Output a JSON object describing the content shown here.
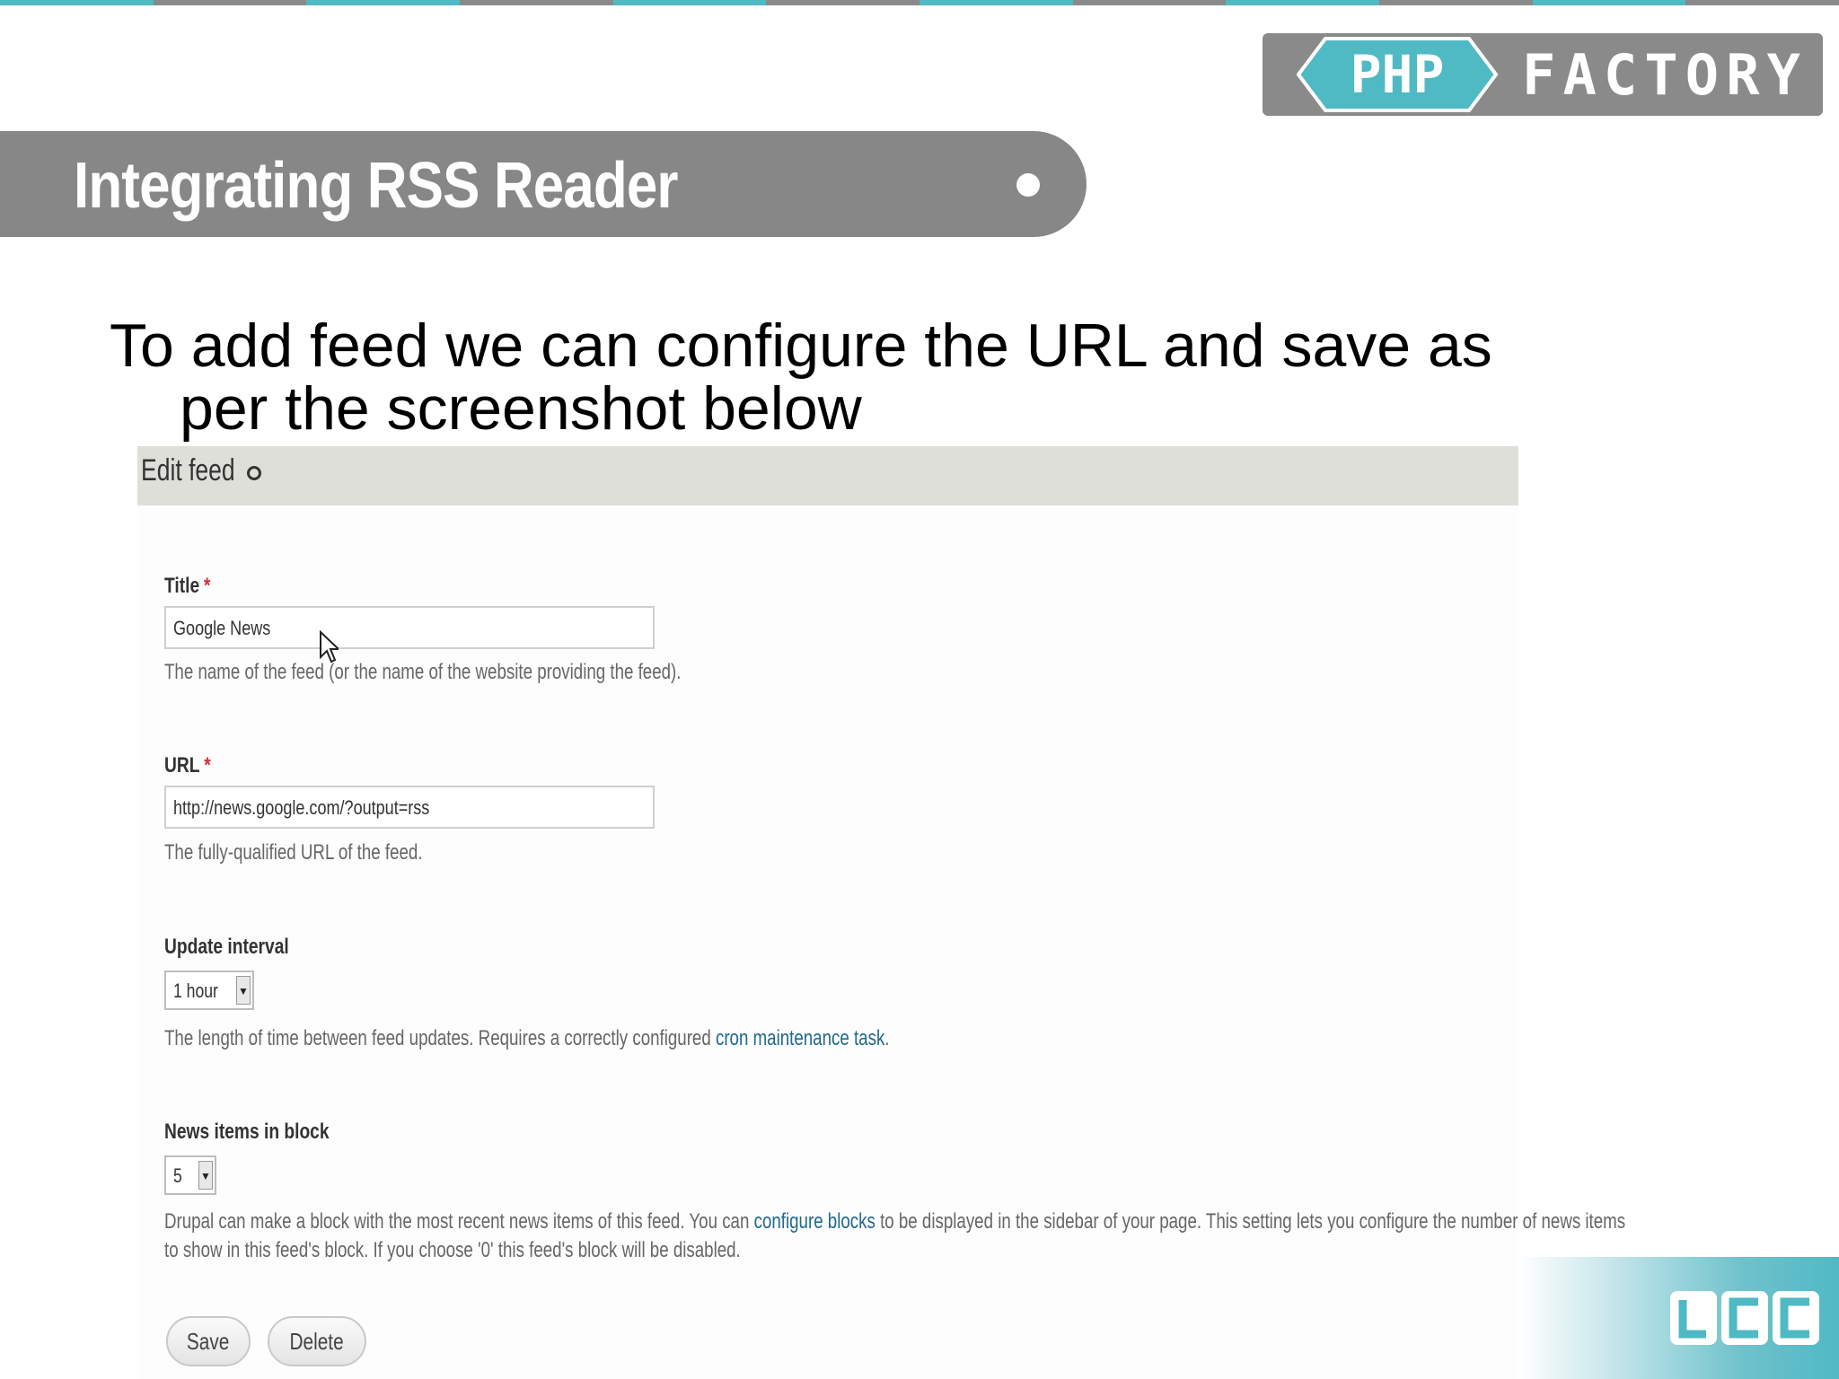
{
  "slide": {
    "title": "Integrating RSS Reader",
    "intro_line1": "To add feed we can configure the URL and save as",
    "intro_line2": "per the screenshot below"
  },
  "logo": {
    "left": "PHP",
    "right": "FACTORY"
  },
  "corner_logo": {
    "text": "LCC"
  },
  "form": {
    "header": "Edit feed",
    "title_field": {
      "label": "Title",
      "required_mark": "*",
      "value": "Google News",
      "description": "The name of the feed (or the name of the website providing the feed)."
    },
    "url_field": {
      "label": "URL",
      "required_mark": "*",
      "value": "http://news.google.com/?output=rss",
      "description": "The fully-qualified URL of the feed."
    },
    "interval_field": {
      "label": "Update interval",
      "value": "1 hour",
      "description_prefix": "The length of time between feed updates. Requires a correctly configured ",
      "description_link": "cron maintenance task",
      "description_suffix": "."
    },
    "block_field": {
      "label": "News items in block",
      "value": "5",
      "description_prefix": "Drupal can make a block with the most recent news items of this feed. You can ",
      "description_link": "configure blocks",
      "description_suffix": " to be displayed in the sidebar of your page. This setting lets you configure the number of news items",
      "description_line2": "to show in this feed's block. If you choose '0' this feed's block will be disabled."
    },
    "save_label": "Save",
    "delete_label": "Delete"
  },
  "colors": {
    "accent_teal": "#4fb9c4",
    "title_band": "#878787",
    "form_header": "#dfdfd9",
    "link": "#1e6a8d",
    "required": "#cc3333"
  }
}
